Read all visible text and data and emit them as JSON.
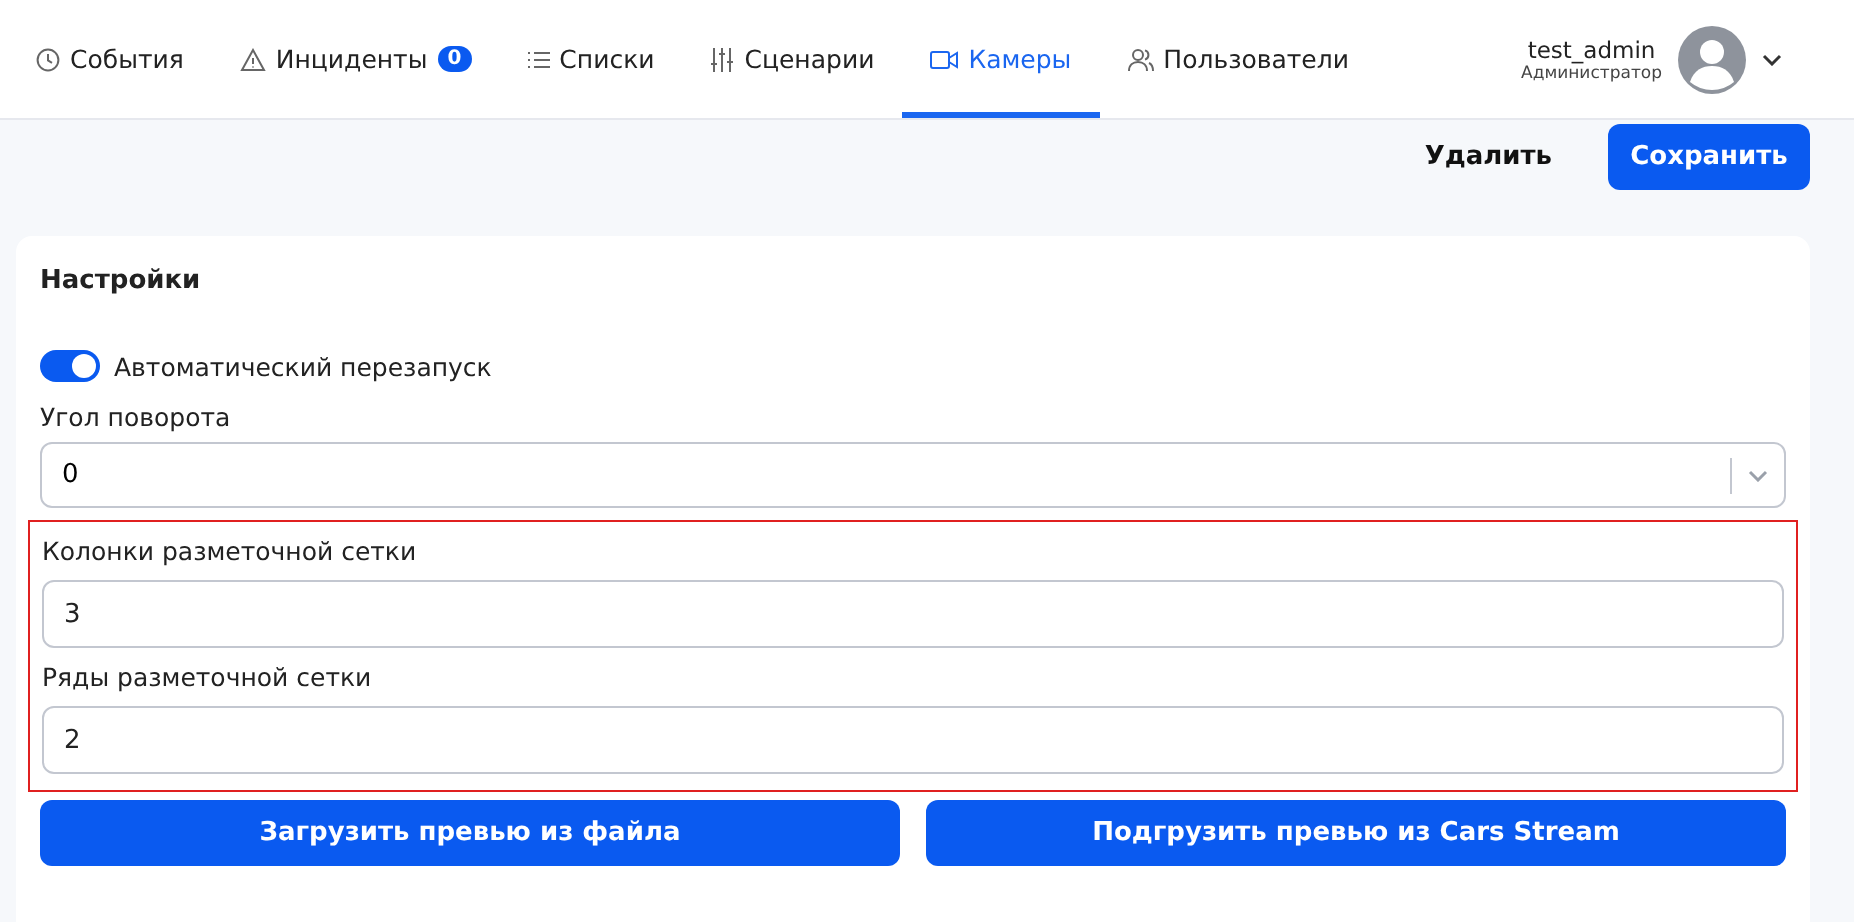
{
  "nav": {
    "tabs": [
      {
        "label": "События",
        "selected": false
      },
      {
        "label": "Инциденты",
        "badge": "0",
        "selected": false
      },
      {
        "label": "Списки",
        "selected": false
      },
      {
        "label": "Сценарии",
        "selected": false
      },
      {
        "label": "Камеры",
        "selected": true
      },
      {
        "label": "Пользователи",
        "selected": false
      }
    ],
    "user": {
      "name": "test_admin",
      "role": "Администратор"
    }
  },
  "actions": {
    "delete": "Удалить",
    "save": "Сохранить"
  },
  "settings": {
    "title": "Настройки",
    "auto_restart": {
      "label": "Автоматический перезапуск",
      "on": true
    },
    "rotation": {
      "label": "Угол поворота",
      "value": "0"
    },
    "grid_section": {
      "highlighted": true,
      "fields": [
        {
          "label": "Колонки разметочной сетки",
          "value": "3"
        },
        {
          "label": "Ряды разметочной сетки",
          "value": "2"
        }
      ]
    },
    "buttons": [
      "Загрузить превью из файла",
      "Подгрузить превью из Cars Stream"
    ]
  }
}
